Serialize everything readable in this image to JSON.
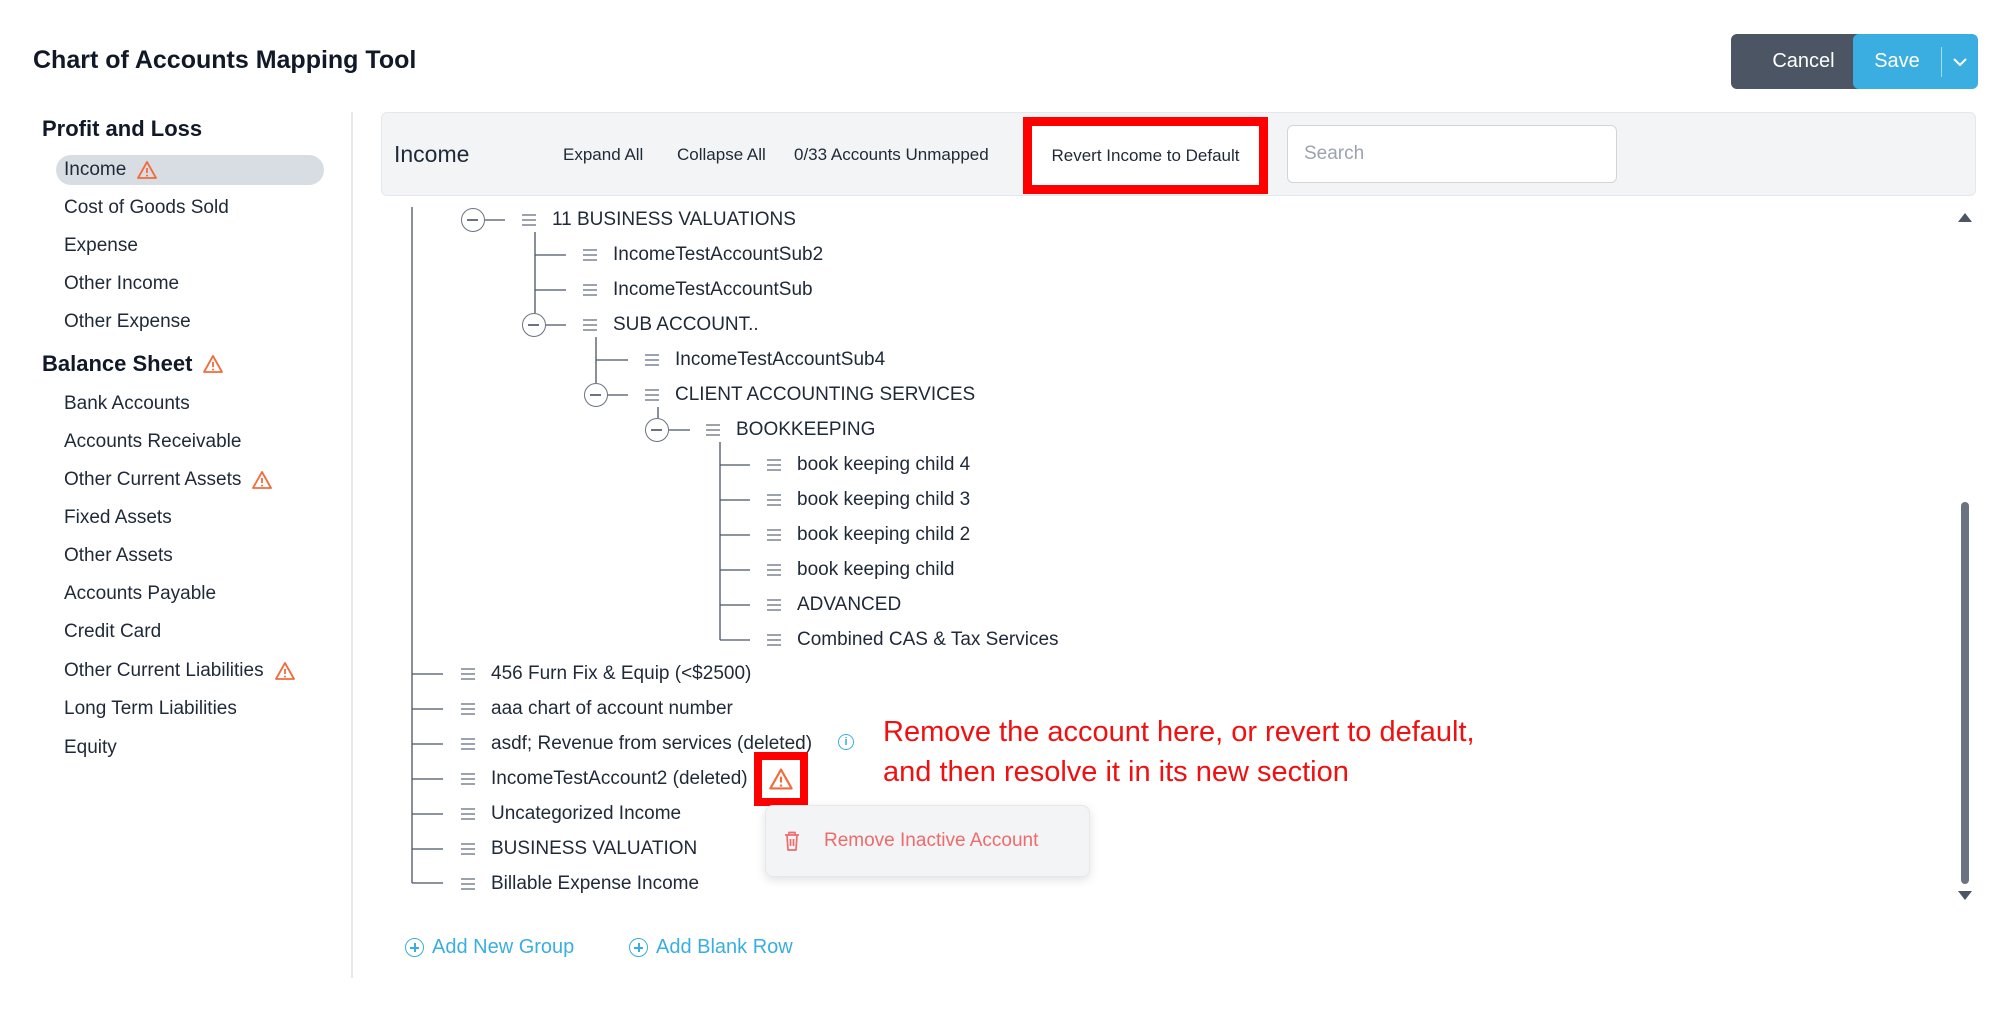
{
  "header": {
    "title": "Chart of Accounts Mapping Tool",
    "cancel_label": "Cancel",
    "save_label": "Save"
  },
  "sidebar": {
    "profit_loss_heading": "Profit and Loss",
    "balance_sheet_heading": "Balance Sheet",
    "items": [
      {
        "label": "Income",
        "warning": true,
        "active": true
      },
      {
        "label": "Cost of Goods Sold",
        "warning": false
      },
      {
        "label": "Expense",
        "warning": false
      },
      {
        "label": "Other Income",
        "warning": false
      },
      {
        "label": "Other Expense",
        "warning": false
      },
      {
        "label": "Bank Accounts",
        "warning": false
      },
      {
        "label": "Accounts Receivable",
        "warning": false
      },
      {
        "label": "Other Current Assets",
        "warning": true
      },
      {
        "label": "Fixed Assets",
        "warning": false
      },
      {
        "label": "Other Assets",
        "warning": false
      },
      {
        "label": "Accounts Payable",
        "warning": false
      },
      {
        "label": "Credit Card",
        "warning": false
      },
      {
        "label": "Other Current Liabilities",
        "warning": true
      },
      {
        "label": "Long Term Liabilities",
        "warning": false
      },
      {
        "label": "Equity",
        "warning": false
      }
    ]
  },
  "toolbar": {
    "section_title": "Income",
    "expand_all": "Expand All",
    "collapse_all": "Collapse All",
    "unmapped_status": "0/33 Accounts Unmapped",
    "revert_label": "Revert Income to Default",
    "search_placeholder": "Search"
  },
  "tree": {
    "nodes": [
      "11 BUSINESS VALUATIONS",
      "IncomeTestAccountSub2",
      "IncomeTestAccountSub",
      "SUB ACCOUNT..",
      "IncomeTestAccountSub4",
      "CLIENT ACCOUNTING SERVICES",
      "BOOKKEEPING",
      "book keeping child 4",
      "book keeping child 3",
      "book keeping child 2",
      "book keeping child",
      "ADVANCED",
      "Combined CAS & Tax Services",
      "456 Furn Fix & Equip (<$2500)",
      "aaa chart of account number",
      "asdf; Revenue from services (deleted)",
      "IncomeTestAccount2 (deleted)",
      "Uncategorized Income",
      "BUSINESS VALUATION",
      "Billable Expense Income"
    ]
  },
  "popover": {
    "remove_inactive_label": "Remove Inactive Account"
  },
  "annotation": {
    "line1": "Remove the account here, or revert to default,",
    "line2": "and then resolve it in its new section"
  },
  "footer": {
    "add_group_label": "Add New Group",
    "add_row_label": "Add Blank Row"
  },
  "colors": {
    "accent": "#3aaee0",
    "warning": "#f26b3a",
    "highlight": "#ff0000",
    "cancel_bg": "#4b5563"
  }
}
